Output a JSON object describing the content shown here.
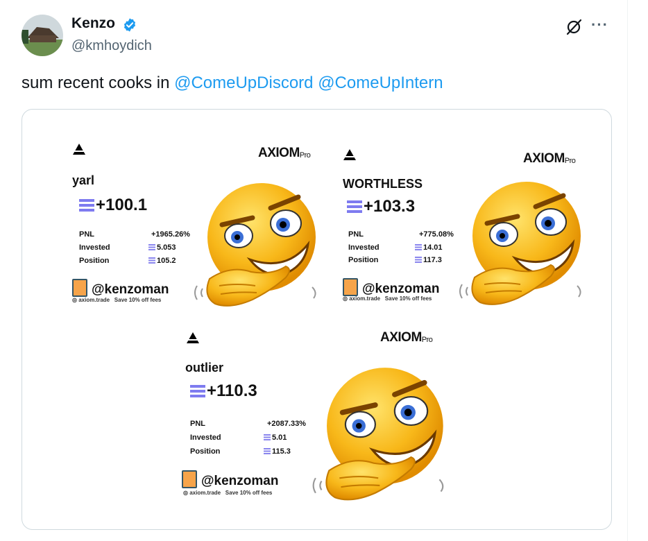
{
  "author": {
    "name": "Kenzo",
    "handle": "@kmhoydich"
  },
  "tweet": {
    "text": "sum recent cooks in ",
    "mentions": [
      "@ComeUpDiscord",
      "@ComeUpIntern"
    ]
  },
  "icons": {
    "verified": "verified-badge-icon",
    "grok": "grok-icon",
    "more": "more-icon"
  },
  "colors": {
    "mention": "#1d9bf0",
    "verified": "#1d9bf0",
    "emoji": "#f5b800"
  },
  "cards": [
    {
      "brand": "AXIOM",
      "brand_sub": "Pro",
      "token": "yarl",
      "pnl_big": "+100.1",
      "rows": [
        {
          "label": "PNL",
          "value": "+1965.26%"
        },
        {
          "label": "Invested",
          "value": "5.053"
        },
        {
          "label": "Position",
          "value": "105.2"
        }
      ],
      "user": "@kenzoman",
      "footer_site": "axiom.trade",
      "footer_promo": "Save 10% off fees"
    },
    {
      "brand": "AXIOM",
      "brand_sub": "Pro",
      "token": "WORTHLESS",
      "pnl_big": "+103.3",
      "rows": [
        {
          "label": "PNL",
          "value": "+775.08%"
        },
        {
          "label": "Invested",
          "value": "14.01"
        },
        {
          "label": "Position",
          "value": "117.3"
        }
      ],
      "user": "@kenzoman",
      "footer_site": "axiom.trade",
      "footer_promo": "Save 10% off fees"
    },
    {
      "brand": "AXIOM",
      "brand_sub": "Pro",
      "token": "outlier",
      "pnl_big": "+110.3",
      "rows": [
        {
          "label": "PNL",
          "value": "+2087.33%"
        },
        {
          "label": "Invested",
          "value": "5.01"
        },
        {
          "label": "Position",
          "value": "115.3"
        }
      ],
      "user": "@kenzoman",
      "footer_site": "axiom.trade",
      "footer_promo": "Save 10% off fees"
    }
  ]
}
